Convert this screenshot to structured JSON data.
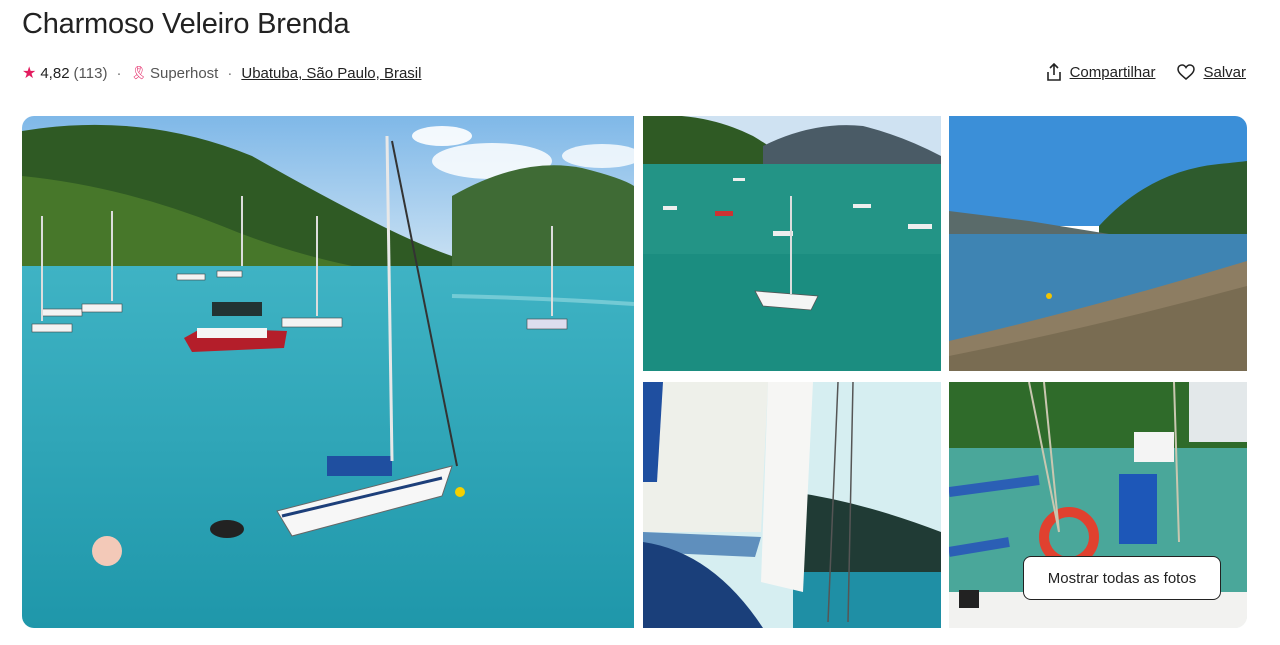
{
  "listing": {
    "title": "Charmoso Veleiro Brenda",
    "rating": "4,82",
    "reviews": "(113)",
    "superhost": "Superhost",
    "location": "Ubatuba, São Paulo, Brasil"
  },
  "actions": {
    "share_label": "Compartilhar",
    "save_label": "Salvar"
  },
  "gallery": {
    "show_all_label": "Mostrar todas as fotos"
  },
  "icons": {
    "star": "star-icon",
    "superhost": "superhost-medal-icon",
    "share": "share-icon",
    "save": "heart-icon"
  },
  "colors": {
    "brand": "#e31c5f",
    "text": "#222222",
    "muted": "#717171"
  }
}
